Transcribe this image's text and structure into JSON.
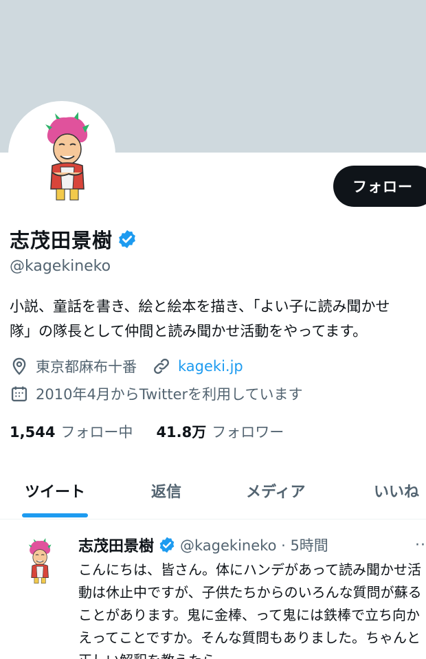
{
  "profile": {
    "name": "志茂田景樹",
    "handle": "@kagekineko",
    "follow_label": "フォロー",
    "bio_line1": "小説、童話を書き、絵と絵本を描き、「よい子に読み聞かせ",
    "bio_line2": "隊」の隊長として仲間と読み聞かせ活動をやってます。",
    "location": "東京都麻布十番",
    "website": "kageki.jp",
    "joined": "2010年4月からTwitterを利用しています",
    "following_count": "1,544",
    "following_label": "フォロー中",
    "followers_count": "41.8万",
    "followers_label": "フォロワー"
  },
  "tabs": [
    {
      "label": "ツイート"
    },
    {
      "label": "返信"
    },
    {
      "label": "メディア"
    },
    {
      "label": "いいね"
    }
  ],
  "tweet": {
    "name": "志茂田景樹",
    "handle_time": "@kagekineko · 5時間",
    "more": "··",
    "text": "こんにちは、皆さん。体にハンデがあって読み聞かせ活動は休止中ですが、子供たちからのいろんな質問が蘇ることがあります。鬼に金棒、って鬼には鉄棒で立ち向かえってことですか。そんな質問もありました。ちゃんと正しい解釈を教えたら"
  },
  "colors": {
    "accent": "#1d9bf0",
    "banner": "#cfd9de",
    "text": "#0f1419",
    "muted": "#536471"
  },
  "icons": [
    "verified-badge-icon",
    "location-pin-icon",
    "link-icon",
    "calendar-icon",
    "more-icon"
  ]
}
